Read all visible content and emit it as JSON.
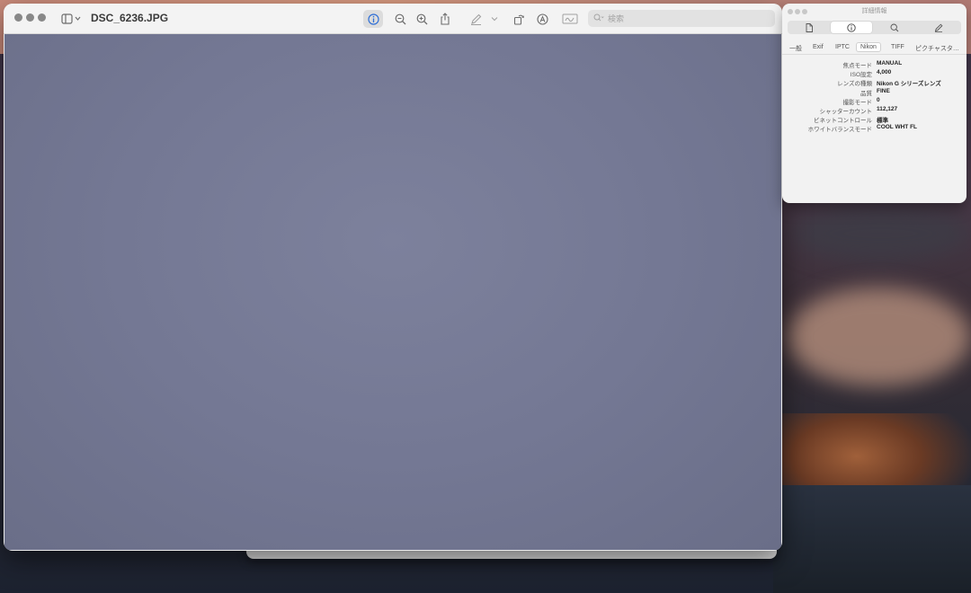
{
  "window": {
    "filename": "DSC_6236.JPG",
    "search_placeholder": "検索"
  },
  "toolbar": {
    "icons": [
      "sidebar-toggle-icon",
      "info-icon",
      "zoom-out-icon",
      "zoom-in-icon",
      "share-icon",
      "markup-icon",
      "rotate-icon",
      "annotate-icon",
      "signature-icon"
    ]
  },
  "inspector": {
    "title": "詳細情報",
    "segments": [
      "file-icon",
      "info-icon",
      "search-icon",
      "markup-icon"
    ],
    "tabs": [
      "一般",
      "Exif",
      "IPTC",
      "Nikon",
      "TIFF",
      "ピクチャスタ…"
    ],
    "active_tab": "Nikon",
    "rows": [
      {
        "key": "焦点モード",
        "value": "MANUAL"
      },
      {
        "key": "ISO設定",
        "value": "4,000"
      },
      {
        "key": "レンズの種類",
        "value": "Nikon G シリーズレンズ"
      },
      {
        "key": "品質",
        "value": "FINE"
      },
      {
        "key": "撮影モード",
        "value": "0"
      },
      {
        "key": "シャッターカウント",
        "value": "112,127"
      },
      {
        "key": "ビネットコントロール",
        "value": "標準"
      },
      {
        "key": "ホワイトバランスモード",
        "value": "COOL WHT FL"
      }
    ]
  },
  "back_window": {
    "ghost_text": "…"
  }
}
